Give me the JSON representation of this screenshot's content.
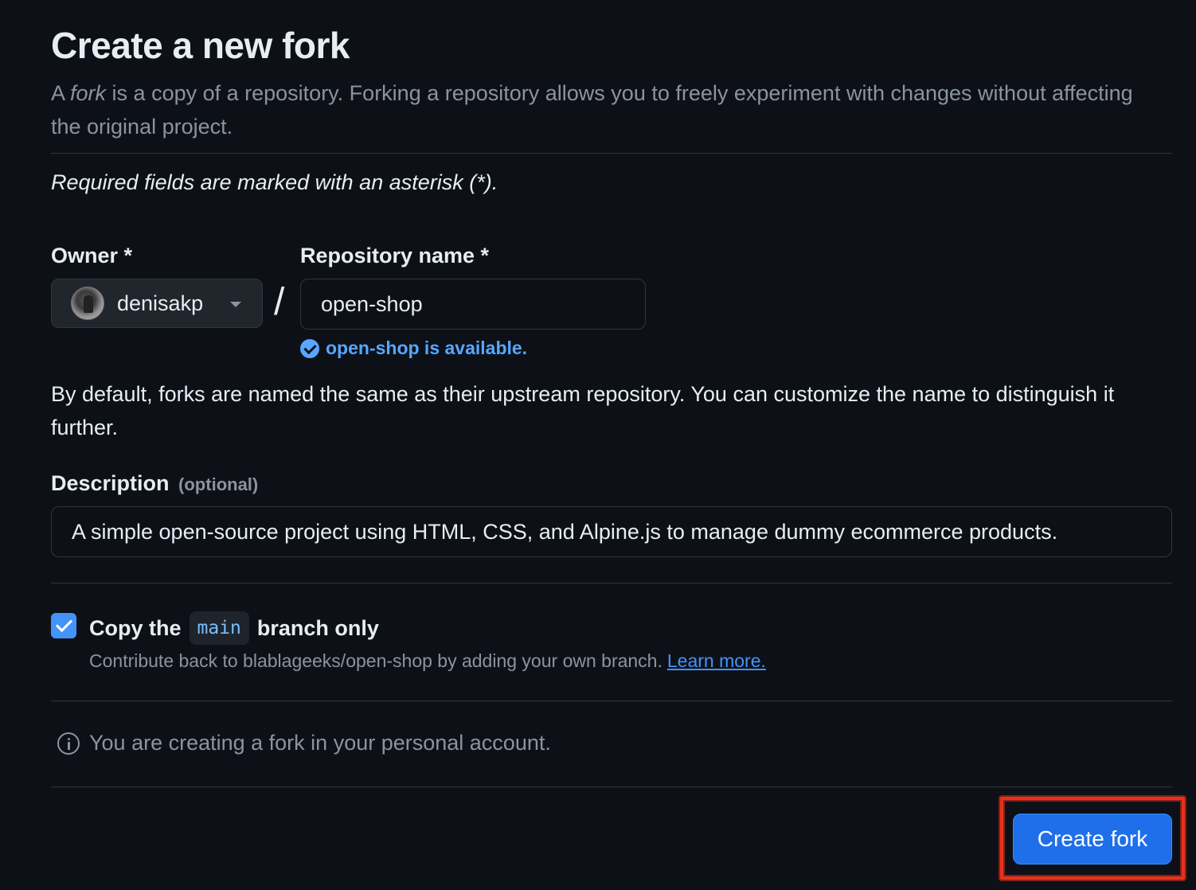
{
  "header": {
    "title": "Create a new fork",
    "intro_prefix": "A ",
    "intro_em": "fork",
    "intro_rest": " is a copy of a repository. Forking a repository allows you to freely experiment with changes without affecting the original project."
  },
  "form": {
    "required_note": "Required fields are marked with an asterisk (*).",
    "owner": {
      "label": "Owner *",
      "value": "denisakp",
      "avatar_icon": "user-avatar"
    },
    "slash": "/",
    "repo_name": {
      "label": "Repository name *",
      "value": "open-shop",
      "availability": "open-shop is available.",
      "availability_icon": "check-circle-icon"
    },
    "naming_help": "By default, forks are named the same as their upstream repository. You can customize the name to distinguish it further.",
    "description": {
      "label": "Description",
      "optional": "(optional)",
      "value": "A simple open-source project using HTML, CSS, and Alpine.js to manage dummy ecommerce products."
    },
    "copy_branch": {
      "checked": true,
      "label_before": "Copy the",
      "branch": "main",
      "label_after": "branch only",
      "help_text": "Contribute back to blablageeks/open-shop by adding your own branch.",
      "learn_more": "Learn more."
    },
    "info_note": "You are creating a fork in your personal account.",
    "submit_label": "Create fork"
  },
  "colors": {
    "background": "#0d1117",
    "primary_button": "#1f6feb",
    "link": "#4493f8",
    "highlight_box": "#e5321a"
  }
}
